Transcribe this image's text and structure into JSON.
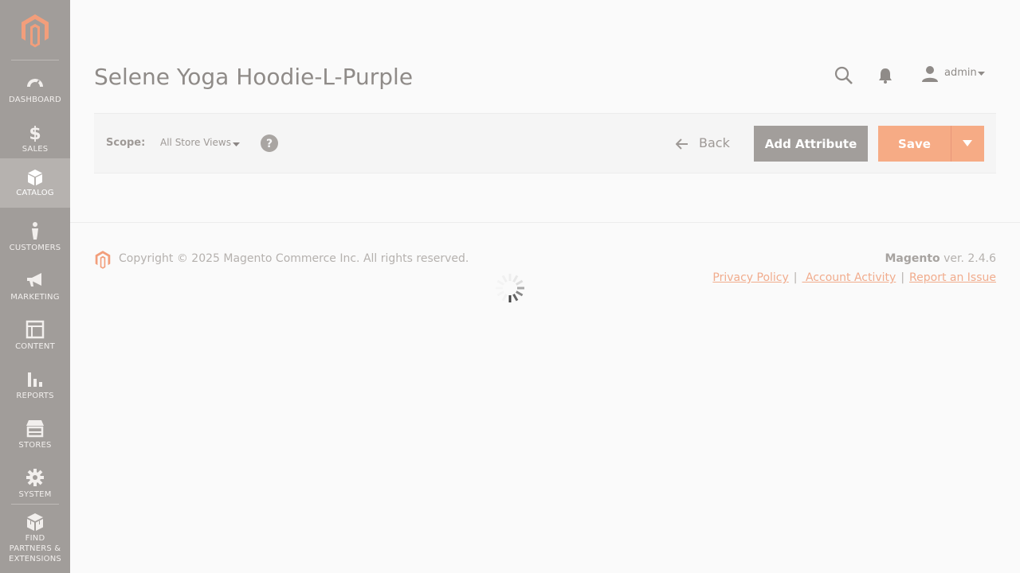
{
  "page": {
    "title": "Selene Yoga Hoodie-L-Purple"
  },
  "sidebar": {
    "items": [
      {
        "label": "DASHBOARD",
        "icon": "dashboard-icon"
      },
      {
        "label": "SALES",
        "icon": "dollar-icon"
      },
      {
        "label": "CATALOG",
        "icon": "box-icon",
        "active": true
      },
      {
        "label": "CUSTOMERS",
        "icon": "person-icon"
      },
      {
        "label": "MARKETING",
        "icon": "megaphone-icon"
      },
      {
        "label": "CONTENT",
        "icon": "layout-icon"
      },
      {
        "label": "REPORTS",
        "icon": "bar-chart-icon"
      },
      {
        "label": "STORES",
        "icon": "store-icon"
      },
      {
        "label": "SYSTEM",
        "icon": "gear-icon"
      }
    ],
    "partners": {
      "label_line1": "FIND",
      "label_line2": "PARTNERS &",
      "label_line3": "EXTENSIONS",
      "icon": "cubes-icon"
    }
  },
  "header": {
    "admin_label": "admin"
  },
  "action_bar": {
    "scope_label": "Scope:",
    "scope_value": "All Store Views",
    "back_label": "Back",
    "add_attribute_label": "Add Attribute",
    "save_label": "Save"
  },
  "footer": {
    "copyright": "Copyright © 2025 Magento Commerce Inc. All rights reserved.",
    "brand": "Magento",
    "version": " ver. 2.4.6",
    "links": {
      "privacy": "Privacy Policy",
      "account_activity": " Account Activity",
      "report_issue": "Report an Issue"
    }
  },
  "colors": {
    "sidebar_bg": "#a19d9a",
    "accent": "#f6ab85",
    "secondary_button": "#a29e9b"
  }
}
